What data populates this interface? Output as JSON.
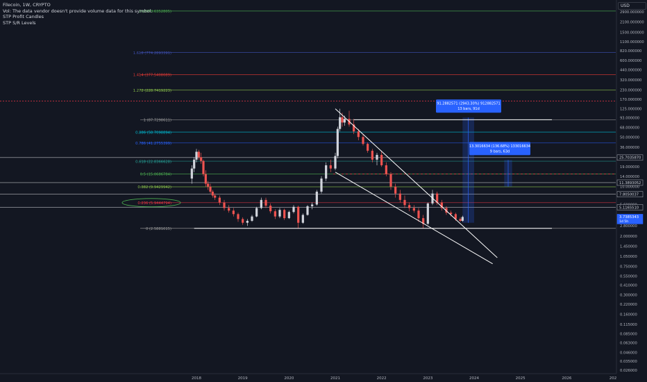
{
  "legend": {
    "symbol_line": "Filecoin, 1W, CRYPTO",
    "vol_note": "Vol: The data vendor doesn't provide volume data for this symbol.",
    "indicator_1": "STP Profit Candles",
    "indicator_2": "STP S/R Levels"
  },
  "currency_label": "USD",
  "colors": {
    "background": "#131722",
    "up": "#d1d4dc",
    "down": "#ef5350",
    "fib_extension_top": "#4caf50",
    "fib_1618": "#3f51b5",
    "fib_1414": "#e53935",
    "fib_1272": "#8bc34a",
    "fib_1": "#9e9e9e",
    "fib_0886": "#00bcd4",
    "fib_0786": "#2962ff",
    "fib_0618": "#26a69a",
    "fib_05": "#4caf50",
    "fib_0382": "#8bc34a",
    "fib_0236": "#f23645",
    "fib_0": "#9e9e9e",
    "measure_box": "#2962ff",
    "trendline": "#ffffff",
    "highlight_ellipse": "#4caf50"
  },
  "chart_data": {
    "type": "candlestick",
    "symbol": "Filecoin",
    "interval": "1W",
    "y_scale": "log",
    "y_ticks": [
      "2900.000000",
      "2100.000000",
      "1500.000000",
      "1100.000000",
      "820.000000",
      "600.000000",
      "440.000000",
      "320.000000",
      "230.000000",
      "170.000000",
      "125.000000",
      "93.000000",
      "68.000000",
      "50.000000",
      "36.000000",
      "26.000000",
      "19.000000",
      "14.000000",
      "10.000000",
      "7.800000",
      "5.600000",
      "3.800000",
      "2.800000",
      "2.000000",
      "1.450000",
      "1.050000",
      "0.750000",
      "0.550000",
      "0.410000",
      "0.300000",
      "0.220000",
      "0.160000",
      "0.115000",
      "0.085000",
      "0.063000",
      "0.046000",
      "0.035000",
      "0.026000"
    ],
    "x_ticks": [
      "2018",
      "2019",
      "2020",
      "2021",
      "2022",
      "2023",
      "2024",
      "2025",
      "2026",
      "202"
    ],
    "fib_levels": [
      {
        "label": "2 (2973.6352805)",
        "value": 2973.6352805,
        "color_key": "fib_extension_top"
      },
      {
        "label": "1.618 (774.2893391)",
        "value": 774.2893391,
        "color_key": "fib_1618"
      },
      {
        "label": "1.414 (377.5408089)",
        "value": 377.5408089,
        "color_key": "fib_1414"
      },
      {
        "label": "1.272 (228.7419223)",
        "value": 228.7419223,
        "color_key": "fib_1272"
      },
      {
        "label": "1 (87.7298611)",
        "value": 87.7298611,
        "color_key": "fib_1"
      },
      {
        "label": "0.886 (58.7098894)",
        "value": 58.7098894,
        "color_key": "fib_0886"
      },
      {
        "label": "0.786 (41.2755399)",
        "value": 41.2755399,
        "color_key": "fib_0786"
      },
      {
        "label": "0.618 (22.8366628)",
        "value": 22.8366628,
        "color_key": "fib_0618"
      },
      {
        "label": "0.5 (15.0686784)",
        "value": 15.0686784,
        "color_key": "fib_05"
      },
      {
        "label": "0.382 (9.9429942)",
        "value": 9.9429942,
        "color_key": "fib_0382"
      },
      {
        "label": "0.236 (5.9444794)",
        "value": 5.9444794,
        "color_key": "fib_0236"
      },
      {
        "label": "0 (2.5881615)",
        "value": 2.5881615,
        "color_key": "fib_0"
      }
    ],
    "price_badges": [
      {
        "label": "25.7035870",
        "value": 25.703587,
        "bg": "#131722",
        "fg": "#d1d4dc"
      },
      {
        "label": "11.3893052",
        "value": 11.3893052,
        "bg": "#131722",
        "fg": "#d1d4dc"
      },
      {
        "label": "7.8050037",
        "value": 7.8050037,
        "bg": "#131722",
        "fg": "#d1d4dc"
      },
      {
        "label": "5.1165510",
        "value": 5.116551,
        "bg": "#131722",
        "fg": "#d1d4dc"
      },
      {
        "label": "3.7385343",
        "sub": "1d 5h",
        "value": 3.7385343,
        "bg": "#2962ff",
        "fg": "#ffffff"
      }
    ],
    "measurements": [
      {
        "line1": "91.2882571 (2943.30%) 912882571",
        "line2": "13 bars, 91d",
        "from_date": 2023.75,
        "to_date": 2024.0,
        "from_value": 3.1,
        "to_value": 94
      },
      {
        "line1": "13.3016634 (136.68%) 133016634",
        "line2": "9 bars, 63d",
        "from_date": 2024.65,
        "to_date": 2024.82,
        "from_value": 10.0,
        "to_value": 23.7
      }
    ],
    "trendlines": [
      {
        "x1": 2021.0,
        "y1": 125,
        "x2": 2024.5,
        "y2": 1.0
      },
      {
        "x1": 2021.0,
        "y1": 16,
        "x2": 2024.4,
        "y2": 0.82
      },
      {
        "x1": 2021.4,
        "y1": 87.73,
        "x2": 2025.68,
        "y2": 87.73
      },
      {
        "x1": 2017.95,
        "y1": 2.5881615,
        "x2": 2025.68,
        "y2": 2.5881615
      }
    ],
    "candles": [
      {
        "t": 2017.9,
        "o": 13,
        "h": 20,
        "l": 11,
        "c": 18
      },
      {
        "t": 2017.95,
        "o": 18,
        "h": 26,
        "l": 16,
        "c": 24
      },
      {
        "t": 2018.0,
        "o": 24,
        "h": 34,
        "l": 22,
        "c": 31
      },
      {
        "t": 2018.05,
        "o": 31,
        "h": 33,
        "l": 24,
        "c": 26
      },
      {
        "t": 2018.1,
        "o": 26,
        "h": 30,
        "l": 21,
        "c": 23
      },
      {
        "t": 2018.15,
        "o": 23,
        "h": 24,
        "l": 14,
        "c": 15
      },
      {
        "t": 2018.2,
        "o": 15,
        "h": 17,
        "l": 10,
        "c": 11
      },
      {
        "t": 2018.25,
        "o": 11,
        "h": 12,
        "l": 9,
        "c": 10
      },
      {
        "t": 2018.3,
        "o": 10,
        "h": 11,
        "l": 8,
        "c": 8.5
      },
      {
        "t": 2018.35,
        "o": 8.5,
        "h": 9,
        "l": 7,
        "c": 7.5
      },
      {
        "t": 2018.4,
        "o": 7.5,
        "h": 8,
        "l": 6.5,
        "c": 7
      },
      {
        "t": 2018.5,
        "o": 7,
        "h": 7.5,
        "l": 5.5,
        "c": 6
      },
      {
        "t": 2018.6,
        "o": 6,
        "h": 6.5,
        "l": 4.6,
        "c": 5
      },
      {
        "t": 2018.7,
        "o": 5,
        "h": 5.5,
        "l": 4.3,
        "c": 4.6
      },
      {
        "t": 2018.8,
        "o": 4.6,
        "h": 5,
        "l": 3.8,
        "c": 4.1
      },
      {
        "t": 2018.9,
        "o": 4.1,
        "h": 4.3,
        "l": 3.2,
        "c": 3.5
      },
      {
        "t": 2019.0,
        "o": 3.5,
        "h": 3.7,
        "l": 2.9,
        "c": 3.1
      },
      {
        "t": 2019.1,
        "o": 3.1,
        "h": 3.5,
        "l": 2.8,
        "c": 3.3
      },
      {
        "t": 2019.2,
        "o": 3.3,
        "h": 4,
        "l": 3.2,
        "c": 3.8
      },
      {
        "t": 2019.3,
        "o": 3.8,
        "h": 5.2,
        "l": 3.7,
        "c": 5
      },
      {
        "t": 2019.4,
        "o": 5,
        "h": 7,
        "l": 4.8,
        "c": 6.5
      },
      {
        "t": 2019.5,
        "o": 6.5,
        "h": 7,
        "l": 5,
        "c": 5.4
      },
      {
        "t": 2019.6,
        "o": 5.4,
        "h": 5.8,
        "l": 4.2,
        "c": 4.5
      },
      {
        "t": 2019.7,
        "o": 4.5,
        "h": 4.8,
        "l": 3.5,
        "c": 3.8
      },
      {
        "t": 2019.8,
        "o": 3.8,
        "h": 5,
        "l": 3.6,
        "c": 4.7
      },
      {
        "t": 2019.9,
        "o": 4.7,
        "h": 4.9,
        "l": 3.4,
        "c": 3.6
      },
      {
        "t": 2020.0,
        "o": 3.6,
        "h": 4.6,
        "l": 3.5,
        "c": 4.4
      },
      {
        "t": 2020.1,
        "o": 4.4,
        "h": 5.5,
        "l": 4.2,
        "c": 5.2
      },
      {
        "t": 2020.2,
        "o": 5.2,
        "h": 5.4,
        "l": 2.6,
        "c": 3.1
      },
      {
        "t": 2020.3,
        "o": 3.1,
        "h": 4.2,
        "l": 3,
        "c": 4
      },
      {
        "t": 2020.4,
        "o": 4,
        "h": 5.5,
        "l": 3.9,
        "c": 5.3
      },
      {
        "t": 2020.5,
        "o": 5.3,
        "h": 6,
        "l": 4.8,
        "c": 5.6
      },
      {
        "t": 2020.6,
        "o": 5.6,
        "h": 9,
        "l": 5.4,
        "c": 8.5
      },
      {
        "t": 2020.7,
        "o": 8.5,
        "h": 14,
        "l": 8,
        "c": 13
      },
      {
        "t": 2020.8,
        "o": 13,
        "h": 22,
        "l": 12,
        "c": 20
      },
      {
        "t": 2020.9,
        "o": 20,
        "h": 24,
        "l": 16,
        "c": 18
      },
      {
        "t": 2021.0,
        "o": 18,
        "h": 30,
        "l": 17,
        "c": 27
      },
      {
        "t": 2021.05,
        "o": 27,
        "h": 70,
        "l": 25,
        "c": 65
      },
      {
        "t": 2021.1,
        "o": 65,
        "h": 125,
        "l": 60,
        "c": 95
      },
      {
        "t": 2021.15,
        "o": 95,
        "h": 110,
        "l": 70,
        "c": 80
      },
      {
        "t": 2021.2,
        "o": 80,
        "h": 100,
        "l": 72,
        "c": 90
      },
      {
        "t": 2021.3,
        "o": 90,
        "h": 117,
        "l": 70,
        "c": 75
      },
      {
        "t": 2021.4,
        "o": 75,
        "h": 90,
        "l": 55,
        "c": 60
      },
      {
        "t": 2021.5,
        "o": 60,
        "h": 65,
        "l": 45,
        "c": 50
      },
      {
        "t": 2021.6,
        "o": 50,
        "h": 55,
        "l": 38,
        "c": 40
      },
      {
        "t": 2021.7,
        "o": 40,
        "h": 42,
        "l": 30,
        "c": 32
      },
      {
        "t": 2021.8,
        "o": 32,
        "h": 34,
        "l": 22,
        "c": 24
      },
      {
        "t": 2021.9,
        "o": 24,
        "h": 30,
        "l": 20,
        "c": 28
      },
      {
        "t": 2022.0,
        "o": 28,
        "h": 32,
        "l": 19,
        "c": 20
      },
      {
        "t": 2022.1,
        "o": 20,
        "h": 22,
        "l": 14,
        "c": 15
      },
      {
        "t": 2022.2,
        "o": 15,
        "h": 16,
        "l": 9,
        "c": 10
      },
      {
        "t": 2022.3,
        "o": 10,
        "h": 11,
        "l": 7,
        "c": 8
      },
      {
        "t": 2022.4,
        "o": 8,
        "h": 9,
        "l": 6,
        "c": 6.5
      },
      {
        "t": 2022.5,
        "o": 6.5,
        "h": 7.5,
        "l": 5,
        "c": 5.5
      },
      {
        "t": 2022.6,
        "o": 5.5,
        "h": 6,
        "l": 4.5,
        "c": 5
      },
      {
        "t": 2022.7,
        "o": 5,
        "h": 5.5,
        "l": 4.3,
        "c": 4.6
      },
      {
        "t": 2022.8,
        "o": 4.6,
        "h": 5,
        "l": 3.2,
        "c": 3.6
      },
      {
        "t": 2022.9,
        "o": 3.6,
        "h": 4,
        "l": 2.6,
        "c": 3
      },
      {
        "t": 2023.0,
        "o": 3,
        "h": 6,
        "l": 2.9,
        "c": 5.8
      },
      {
        "t": 2023.1,
        "o": 5.8,
        "h": 9,
        "l": 5.5,
        "c": 8
      },
      {
        "t": 2023.2,
        "o": 8,
        "h": 8.5,
        "l": 5.5,
        "c": 6
      },
      {
        "t": 2023.3,
        "o": 6,
        "h": 6.5,
        "l": 4.6,
        "c": 5
      },
      {
        "t": 2023.4,
        "o": 5,
        "h": 5.3,
        "l": 4,
        "c": 4.3
      },
      {
        "t": 2023.5,
        "o": 4.3,
        "h": 4.6,
        "l": 3.8,
        "c": 4.1
      },
      {
        "t": 2023.6,
        "o": 4.1,
        "h": 4.3,
        "l": 3.3,
        "c": 3.5
      },
      {
        "t": 2023.7,
        "o": 3.5,
        "h": 3.7,
        "l": 3.2,
        "c": 3.3
      },
      {
        "t": 2023.75,
        "o": 3.3,
        "h": 3.9,
        "l": 3.2,
        "c": 3.74
      }
    ]
  }
}
